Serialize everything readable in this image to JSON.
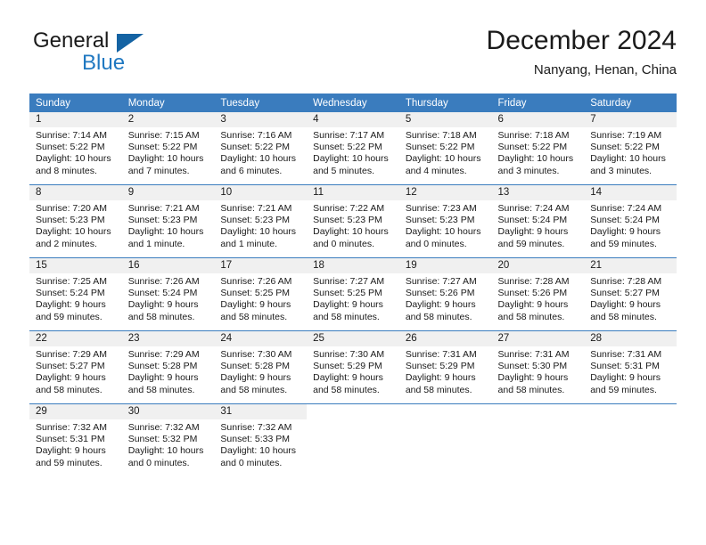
{
  "brand": {
    "name_part1": "General",
    "name_part2": "Blue",
    "logo_icon": "blue-triangle-icon",
    "accent_color": "#1f78c1",
    "header_color": "#3a7cbe"
  },
  "header": {
    "title": "December 2024",
    "subtitle": "Nanyang, Henan, China"
  },
  "weekday_headers": [
    "Sunday",
    "Monday",
    "Tuesday",
    "Wednesday",
    "Thursday",
    "Friday",
    "Saturday"
  ],
  "labels": {
    "sunrise_prefix": "Sunrise:",
    "sunset_prefix": "Sunset:",
    "daylight_prefix": "Daylight:"
  },
  "weeks": [
    [
      {
        "day": "1",
        "sunrise": "Sunrise: 7:14 AM",
        "sunset": "Sunset: 5:22 PM",
        "daylight": "Daylight: 10 hours and 8 minutes."
      },
      {
        "day": "2",
        "sunrise": "Sunrise: 7:15 AM",
        "sunset": "Sunset: 5:22 PM",
        "daylight": "Daylight: 10 hours and 7 minutes."
      },
      {
        "day": "3",
        "sunrise": "Sunrise: 7:16 AM",
        "sunset": "Sunset: 5:22 PM",
        "daylight": "Daylight: 10 hours and 6 minutes."
      },
      {
        "day": "4",
        "sunrise": "Sunrise: 7:17 AM",
        "sunset": "Sunset: 5:22 PM",
        "daylight": "Daylight: 10 hours and 5 minutes."
      },
      {
        "day": "5",
        "sunrise": "Sunrise: 7:18 AM",
        "sunset": "Sunset: 5:22 PM",
        "daylight": "Daylight: 10 hours and 4 minutes."
      },
      {
        "day": "6",
        "sunrise": "Sunrise: 7:18 AM",
        "sunset": "Sunset: 5:22 PM",
        "daylight": "Daylight: 10 hours and 3 minutes."
      },
      {
        "day": "7",
        "sunrise": "Sunrise: 7:19 AM",
        "sunset": "Sunset: 5:22 PM",
        "daylight": "Daylight: 10 hours and 3 minutes."
      }
    ],
    [
      {
        "day": "8",
        "sunrise": "Sunrise: 7:20 AM",
        "sunset": "Sunset: 5:23 PM",
        "daylight": "Daylight: 10 hours and 2 minutes."
      },
      {
        "day": "9",
        "sunrise": "Sunrise: 7:21 AM",
        "sunset": "Sunset: 5:23 PM",
        "daylight": "Daylight: 10 hours and 1 minute."
      },
      {
        "day": "10",
        "sunrise": "Sunrise: 7:21 AM",
        "sunset": "Sunset: 5:23 PM",
        "daylight": "Daylight: 10 hours and 1 minute."
      },
      {
        "day": "11",
        "sunrise": "Sunrise: 7:22 AM",
        "sunset": "Sunset: 5:23 PM",
        "daylight": "Daylight: 10 hours and 0 minutes."
      },
      {
        "day": "12",
        "sunrise": "Sunrise: 7:23 AM",
        "sunset": "Sunset: 5:23 PM",
        "daylight": "Daylight: 10 hours and 0 minutes."
      },
      {
        "day": "13",
        "sunrise": "Sunrise: 7:24 AM",
        "sunset": "Sunset: 5:24 PM",
        "daylight": "Daylight: 9 hours and 59 minutes."
      },
      {
        "day": "14",
        "sunrise": "Sunrise: 7:24 AM",
        "sunset": "Sunset: 5:24 PM",
        "daylight": "Daylight: 9 hours and 59 minutes."
      }
    ],
    [
      {
        "day": "15",
        "sunrise": "Sunrise: 7:25 AM",
        "sunset": "Sunset: 5:24 PM",
        "daylight": "Daylight: 9 hours and 59 minutes."
      },
      {
        "day": "16",
        "sunrise": "Sunrise: 7:26 AM",
        "sunset": "Sunset: 5:24 PM",
        "daylight": "Daylight: 9 hours and 58 minutes."
      },
      {
        "day": "17",
        "sunrise": "Sunrise: 7:26 AM",
        "sunset": "Sunset: 5:25 PM",
        "daylight": "Daylight: 9 hours and 58 minutes."
      },
      {
        "day": "18",
        "sunrise": "Sunrise: 7:27 AM",
        "sunset": "Sunset: 5:25 PM",
        "daylight": "Daylight: 9 hours and 58 minutes."
      },
      {
        "day": "19",
        "sunrise": "Sunrise: 7:27 AM",
        "sunset": "Sunset: 5:26 PM",
        "daylight": "Daylight: 9 hours and 58 minutes."
      },
      {
        "day": "20",
        "sunrise": "Sunrise: 7:28 AM",
        "sunset": "Sunset: 5:26 PM",
        "daylight": "Daylight: 9 hours and 58 minutes."
      },
      {
        "day": "21",
        "sunrise": "Sunrise: 7:28 AM",
        "sunset": "Sunset: 5:27 PM",
        "daylight": "Daylight: 9 hours and 58 minutes."
      }
    ],
    [
      {
        "day": "22",
        "sunrise": "Sunrise: 7:29 AM",
        "sunset": "Sunset: 5:27 PM",
        "daylight": "Daylight: 9 hours and 58 minutes."
      },
      {
        "day": "23",
        "sunrise": "Sunrise: 7:29 AM",
        "sunset": "Sunset: 5:28 PM",
        "daylight": "Daylight: 9 hours and 58 minutes."
      },
      {
        "day": "24",
        "sunrise": "Sunrise: 7:30 AM",
        "sunset": "Sunset: 5:28 PM",
        "daylight": "Daylight: 9 hours and 58 minutes."
      },
      {
        "day": "25",
        "sunrise": "Sunrise: 7:30 AM",
        "sunset": "Sunset: 5:29 PM",
        "daylight": "Daylight: 9 hours and 58 minutes."
      },
      {
        "day": "26",
        "sunrise": "Sunrise: 7:31 AM",
        "sunset": "Sunset: 5:29 PM",
        "daylight": "Daylight: 9 hours and 58 minutes."
      },
      {
        "day": "27",
        "sunrise": "Sunrise: 7:31 AM",
        "sunset": "Sunset: 5:30 PM",
        "daylight": "Daylight: 9 hours and 58 minutes."
      },
      {
        "day": "28",
        "sunrise": "Sunrise: 7:31 AM",
        "sunset": "Sunset: 5:31 PM",
        "daylight": "Daylight: 9 hours and 59 minutes."
      }
    ],
    [
      {
        "day": "29",
        "sunrise": "Sunrise: 7:32 AM",
        "sunset": "Sunset: 5:31 PM",
        "daylight": "Daylight: 9 hours and 59 minutes."
      },
      {
        "day": "30",
        "sunrise": "Sunrise: 7:32 AM",
        "sunset": "Sunset: 5:32 PM",
        "daylight": "Daylight: 10 hours and 0 minutes."
      },
      {
        "day": "31",
        "sunrise": "Sunrise: 7:32 AM",
        "sunset": "Sunset: 5:33 PM",
        "daylight": "Daylight: 10 hours and 0 minutes."
      },
      {
        "day": "",
        "sunrise": "",
        "sunset": "",
        "daylight": ""
      },
      {
        "day": "",
        "sunrise": "",
        "sunset": "",
        "daylight": ""
      },
      {
        "day": "",
        "sunrise": "",
        "sunset": "",
        "daylight": ""
      },
      {
        "day": "",
        "sunrise": "",
        "sunset": "",
        "daylight": ""
      }
    ]
  ]
}
